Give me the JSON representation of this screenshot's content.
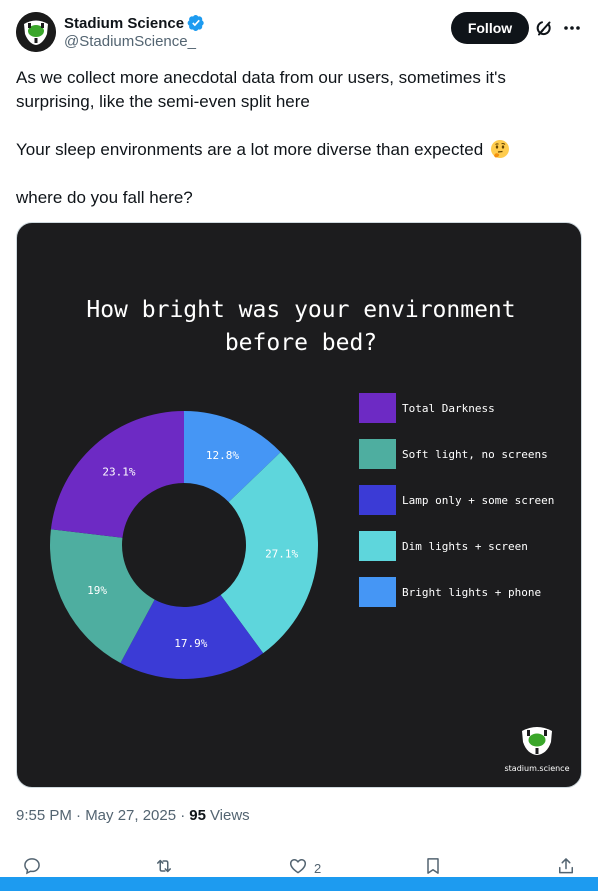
{
  "author": {
    "display_name": "Stadium Science",
    "handle": "@StadiumScience_",
    "verified": true
  },
  "header": {
    "follow_label": "Follow",
    "icons": [
      "grok-icon",
      "more-icon"
    ]
  },
  "tweet": {
    "paragraph_1": "As we collect more anecdotal data from our users, sometimes it's surprising, like the semi-even split here",
    "paragraph_2": "Your sleep environments are a lot more diverse than expected",
    "paragraph_2_emoji": "thinking-face",
    "paragraph_3": "where do you fall here?"
  },
  "media": {
    "watermark": "stadium.science",
    "background": "#1c1c1e"
  },
  "chart_data": {
    "type": "pie",
    "title_line1": "How bright was your environment",
    "title_line2": "before bed?",
    "donut": true,
    "legend_placement": "right",
    "categories": [
      "Total Darkness",
      "Soft light, no screens",
      "Lamp only + some screen",
      "Dim lights + screen",
      "Bright lights + phone"
    ],
    "values": [
      23.1,
      19,
      17.9,
      27.1,
      12.8
    ],
    "labels": [
      "23.1%",
      "19%",
      "17.9%",
      "27.1%",
      "12.8%"
    ],
    "colors": [
      "#6d2ac4",
      "#4eaea0",
      "#3b3bd6",
      "#5ed6dc",
      "#4596f5"
    ],
    "draw_order": [
      4,
      3,
      2,
      1,
      0
    ]
  },
  "meta": {
    "time": "9:55 PM · May 27, 2025 ·",
    "views_count": "95",
    "views_label": "Views"
  },
  "actions": {
    "reply_count": "",
    "repost_count": "",
    "like_count": "2",
    "icons": [
      "reply-icon",
      "repost-icon",
      "like-icon",
      "bookmark-icon",
      "share-icon"
    ]
  },
  "colors": {
    "accent": "#1d9bf0",
    "text_primary": "#0f1419",
    "text_secondary": "#536471"
  }
}
